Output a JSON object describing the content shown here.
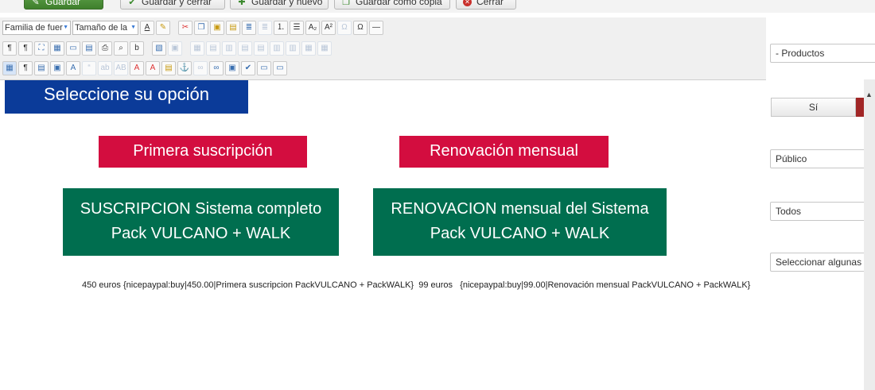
{
  "actions": {
    "save": "Guardar",
    "save_close": "Guardar y cerrar",
    "save_new": "Guardar y nuevo",
    "save_copy": "Guardar como copia",
    "close": "Cerrar"
  },
  "toolbar": {
    "font_family": "Familia de fuer",
    "font_size": "Tamaño de la"
  },
  "content": {
    "banner": "Seleccione su opción",
    "first_button": "Primera suscripción",
    "renew_button": "Renovación mensual",
    "card1_line1": "SUSCRIPCION Sistema completo",
    "card1_line2": "Pack VULCANO + WALK",
    "card2_line1": "RENOVACION mensual del Sistema",
    "card2_line2": "Pack VULCANO + WALK",
    "code_text": "450 euros {nicepaypal:buy|450.00|Primera suscripcion PackVULCANO + PackWALK}  99 euros   {nicepaypal:buy|99.00|Renovación mensual PackVULCANO + PackWALK}"
  },
  "sidebar": {
    "category": "- Productos",
    "toggle_yes": "Sí",
    "access": "Público",
    "language": "Todos",
    "tags_placeholder": "Seleccionar algunas o"
  },
  "colors": {
    "banner_blue": "#0b3b99",
    "button_red": "#d30d3f",
    "card_green": "#006e4f"
  }
}
